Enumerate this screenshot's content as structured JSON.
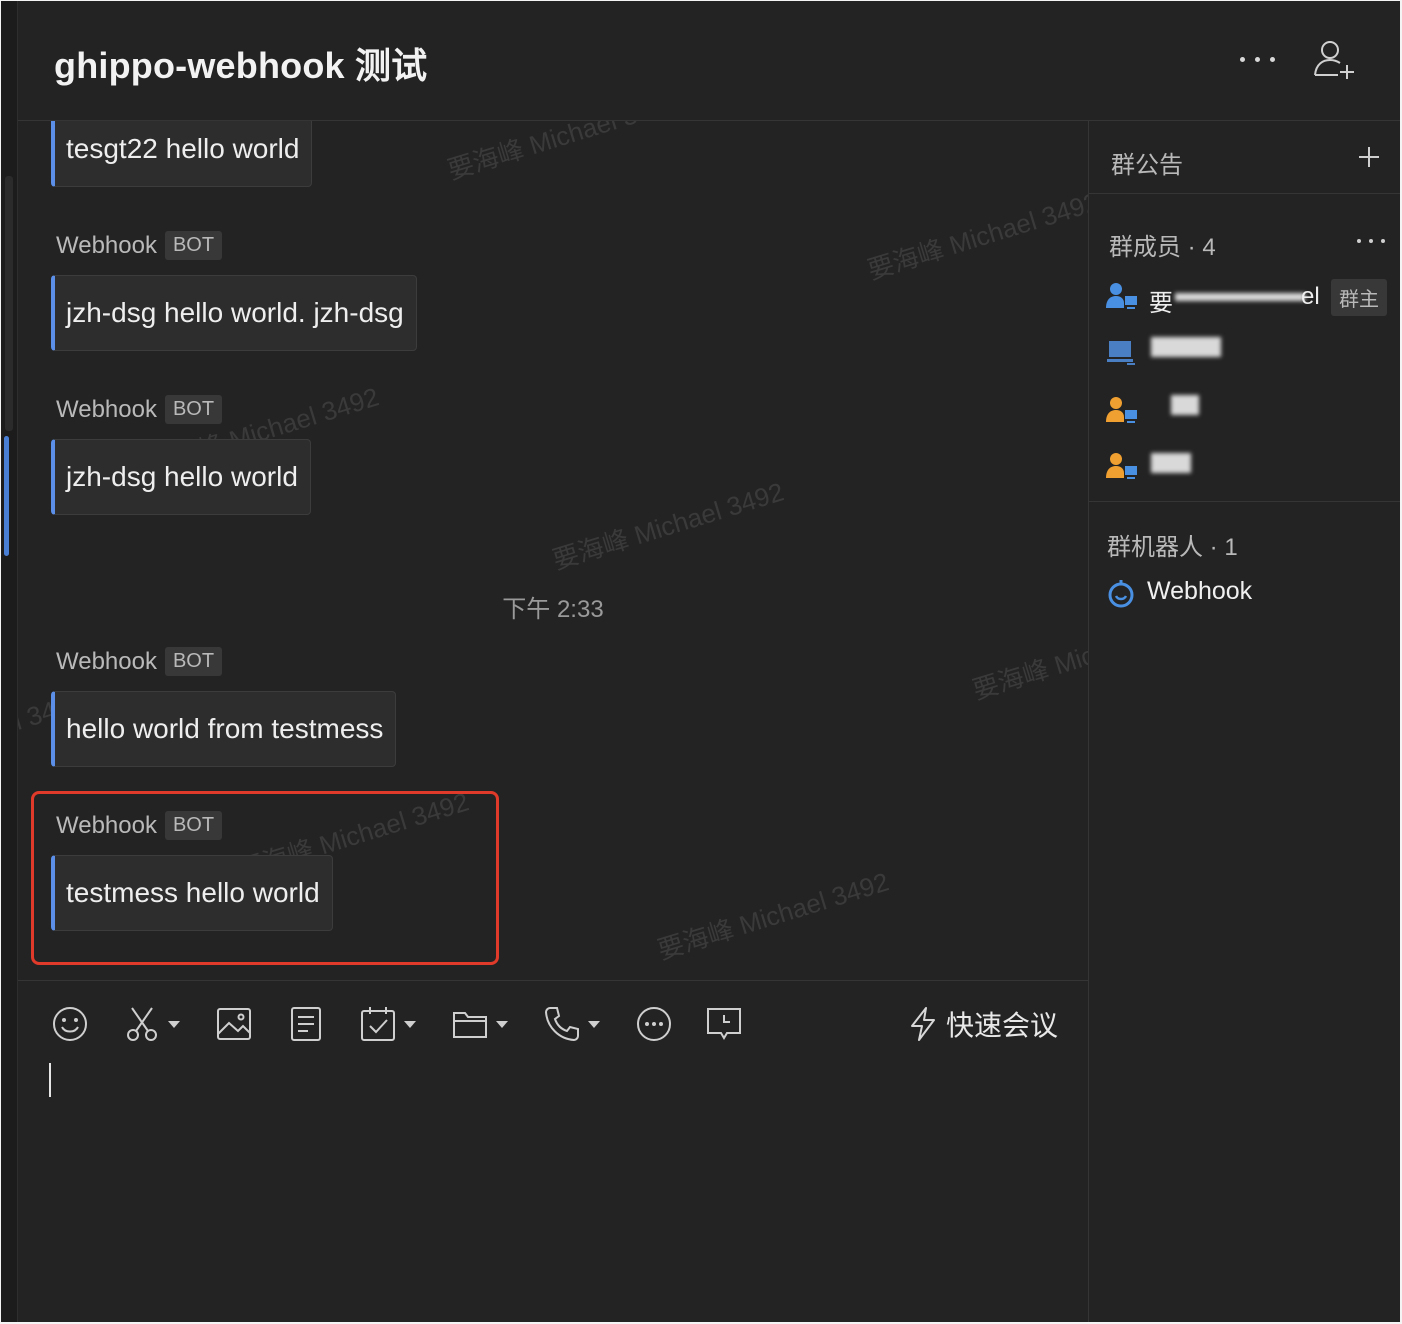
{
  "header": {
    "title": "ghippo-webhook 测试"
  },
  "watermark_text": "要海峰 Michael 3492",
  "messages": [
    {
      "text": "tesgt22 hello world"
    },
    {
      "sender": "Webhook",
      "badge": "BOT",
      "text": "jzh-dsg hello world. jzh-dsg"
    },
    {
      "sender": "Webhook",
      "badge": "BOT",
      "text": "jzh-dsg hello world"
    },
    {
      "sender": "Webhook",
      "badge": "BOT",
      "text": "hello world from testmess"
    },
    {
      "sender": "Webhook",
      "badge": "BOT",
      "text": "testmess hello world"
    }
  ],
  "time_divider": "下午 2:33",
  "composer": {
    "tools": [
      "emoji-icon",
      "scissors-icon",
      "image-icon",
      "document-icon",
      "calendar-check-icon",
      "folder-icon",
      "phone-icon",
      "more-icon",
      "message-clock-icon"
    ],
    "quick_meeting_label": "快速会议"
  },
  "sidebar": {
    "notice_label": "群公告",
    "members_label": "群成员 · 4",
    "members": [
      {
        "name_visible": "要",
        "name_suffix": "el",
        "role_badge": "群主"
      },
      {
        "name_visible": ""
      },
      {
        "name_visible": ""
      },
      {
        "name_visible": ""
      }
    ],
    "bots_label": "群机器人 · 1",
    "bots": [
      {
        "name": "Webhook"
      }
    ]
  },
  "colors": {
    "background": "#232323",
    "bubble": "#2d2d2d",
    "accent": "#5b8fe8",
    "highlight": "#e03a2a"
  }
}
